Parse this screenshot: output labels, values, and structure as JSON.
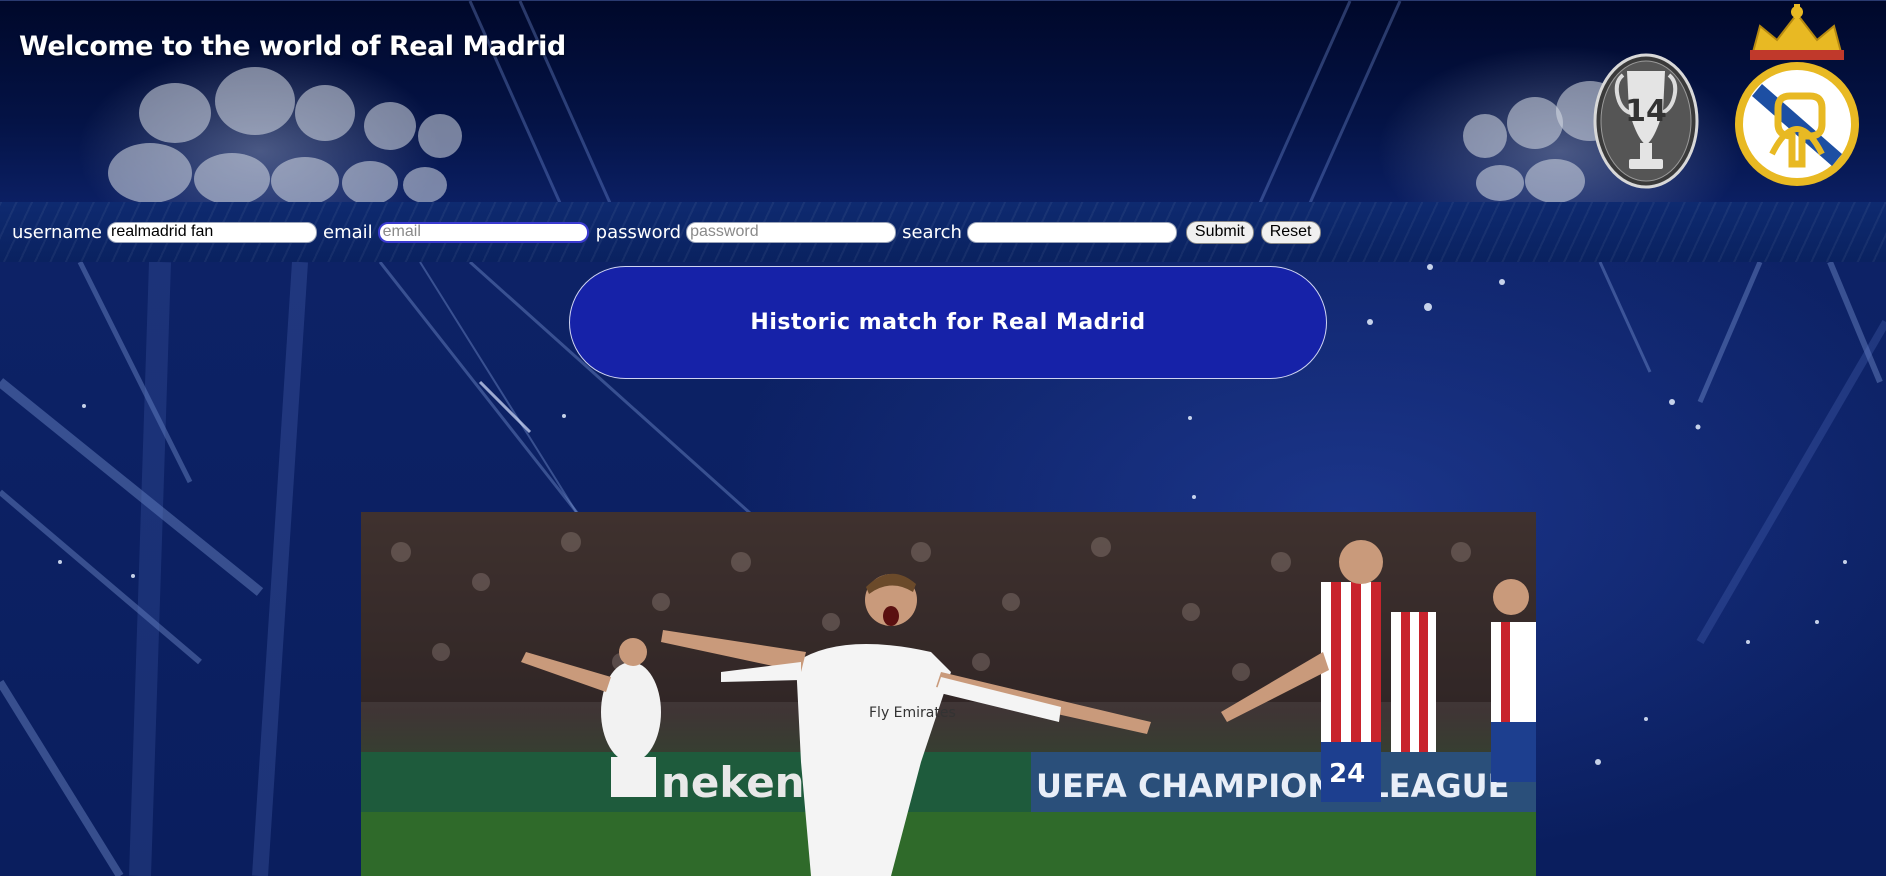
{
  "header": {
    "title": "Welcome to the world of Real Madrid",
    "trophy_badge_text": "14",
    "icons": [
      "champions-trophy-icon",
      "real-madrid-crest-icon"
    ]
  },
  "form": {
    "username_label": "username",
    "username_value": "realmadrid fan",
    "email_label": "email",
    "email_placeholder": "email",
    "password_label": "password",
    "password_placeholder": "password",
    "search_label": "search",
    "search_value": "",
    "submit_label": "Submit",
    "reset_label": "Reset"
  },
  "main": {
    "headline": "Historic match for Real Madrid"
  },
  "photo": {
    "shirt_sponsor": "Fly Emirates",
    "board_left": "neken",
    "board_right": "UEFA CHAMPIONS LEAGUE",
    "opponent_shirt_number": "24"
  },
  "colors": {
    "header_bg": "#041346",
    "form_bar_bg": "#0e2a70",
    "pill_bg": "#1622a8",
    "crest_gold": "#e8b923",
    "crest_blue": "#1d4fa3"
  }
}
